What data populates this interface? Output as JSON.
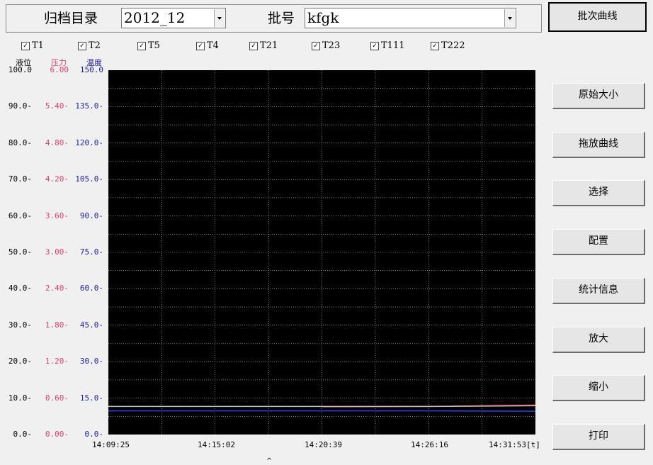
{
  "toolbar": {
    "archive_label": "归档目录",
    "archive_value": "2012_12",
    "batch_label": "批号",
    "batch_value": "kfgk",
    "batch_curve_button": "批次曲线"
  },
  "series_checkboxes": [
    {
      "label": "T1",
      "checked": true
    },
    {
      "label": "T2",
      "checked": true
    },
    {
      "label": "T5",
      "checked": true
    },
    {
      "label": "T4",
      "checked": true
    },
    {
      "label": "T21",
      "checked": true
    },
    {
      "label": "T23",
      "checked": true
    },
    {
      "label": "T111",
      "checked": true
    },
    {
      "label": "T222",
      "checked": true
    }
  ],
  "side_buttons": [
    "原始大小",
    "拖放曲线",
    "选择",
    "配置",
    "统计信息",
    "放大",
    "缩小",
    "打印"
  ],
  "axes": {
    "level": {
      "title": "液位",
      "ticks": [
        "100.0",
        "90.0",
        "80.0",
        "70.0",
        "60.0",
        "50.0",
        "40.0",
        "30.0",
        "20.0",
        "10.0",
        "0.0"
      ],
      "color": "#000000"
    },
    "pressure": {
      "title": "压力",
      "ticks": [
        "6.00",
        "5.40",
        "4.80",
        "4.20",
        "3.60",
        "3.00",
        "2.40",
        "1.80",
        "1.20",
        "0.60",
        "0.00"
      ],
      "color": "#e0407a"
    },
    "temperature": {
      "title": "温度",
      "ticks": [
        "150.0",
        "135.0",
        "120.0",
        "105.0",
        "90.0",
        "75.0",
        "60.0",
        "45.0",
        "30.0",
        "15.0",
        "0.0"
      ],
      "color": "#2020a0"
    }
  },
  "x_ticks": [
    "14:09:25",
    "14:15:02",
    "14:20:39",
    "14:26:16",
    "14:31:53[t]"
  ],
  "chart_data": {
    "type": "line",
    "x": [
      "14:09:25",
      "14:15:02",
      "14:20:39",
      "14:26:16",
      "14:31:53"
    ],
    "xlabel": "[t]",
    "y_axes": [
      {
        "title": "液位",
        "ylim": [
          0,
          100
        ]
      },
      {
        "title": "压力",
        "ylim": [
          0,
          6
        ]
      },
      {
        "title": "温度",
        "ylim": [
          0,
          150
        ]
      }
    ],
    "grid": true,
    "series": [
      {
        "color": "#ff3030",
        "values": [
          null,
          null,
          7.6,
          7.7,
          8.1
        ]
      },
      {
        "color": "#c0c0c0",
        "values": [
          7.7,
          7.7,
          7.7,
          7.7,
          7.9
        ]
      },
      {
        "color": "#2840ff",
        "values": [
          6.5,
          6.5,
          6.5,
          6.5,
          6.4
        ]
      }
    ]
  }
}
